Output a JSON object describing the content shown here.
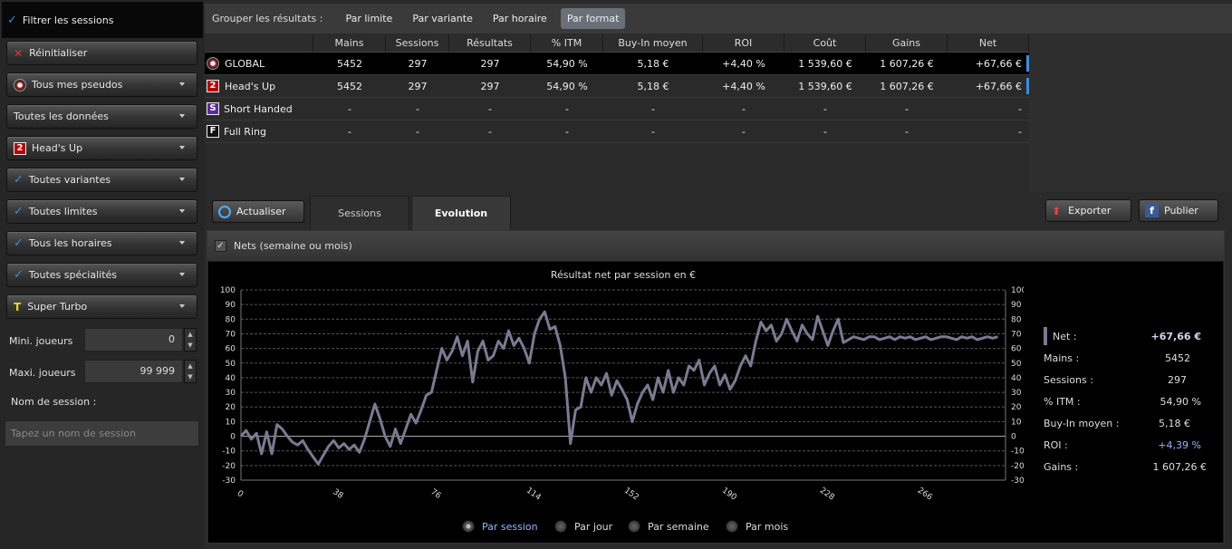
{
  "sidebar": {
    "filter_label": "Filtrer les sessions",
    "reset": "Réinitialiser",
    "pseudos": "Tous mes pseudos",
    "data": "Toutes les données",
    "format": "Head's Up",
    "variants": "Toutes variantes",
    "limits": "Toutes limites",
    "hours": "Tous les horaires",
    "specialities": "Toutes spécialités",
    "speed": "Super Turbo",
    "min_players_label": "Mini. joueurs",
    "min_players_value": "0",
    "max_players_label": "Maxi. joueurs",
    "max_players_value": "99 999",
    "session_name_label": "Nom de session :",
    "session_name_placeholder": "Tapez un nom de session"
  },
  "groupbar": {
    "label": "Grouper les résultats :",
    "tabs": [
      "Par limite",
      "Par variante",
      "Par horaire",
      "Par format"
    ],
    "selected": "Par format"
  },
  "table": {
    "columns": [
      "Mains",
      "Sessions",
      "Résultats",
      "% ITM",
      "Buy-In moyen",
      "ROI",
      "Coût",
      "Gains",
      "Net"
    ],
    "rows": [
      {
        "name": "GLOBAL",
        "icon": "global-icon",
        "cells": [
          "5452",
          "297",
          "297",
          "54,90 %",
          "5,18 €",
          "+4,40 %",
          "1 539,60 €",
          "1 607,26 €",
          "+67,66 €"
        ]
      },
      {
        "name": "Head's Up",
        "icon": "headsup-icon",
        "cells": [
          "5452",
          "297",
          "297",
          "54,90 %",
          "5,18 €",
          "+4,40 %",
          "1 539,60 €",
          "1 607,26 €",
          "+67,66 €"
        ]
      },
      {
        "name": "Short Handed",
        "icon": "shorthanded-icon",
        "cells": [
          "-",
          "-",
          "-",
          "-",
          "-",
          "-",
          "-",
          "-",
          "-"
        ]
      },
      {
        "name": "Full Ring",
        "icon": "fullring-icon",
        "cells": [
          "-",
          "-",
          "-",
          "-",
          "-",
          "-",
          "-",
          "-",
          "-"
        ]
      }
    ]
  },
  "toolbar": {
    "refresh": "Actualiser",
    "tab_sessions": "Sessions",
    "tab_evolution": "Evolution",
    "export": "Exporter",
    "publish": "Publier"
  },
  "panel": {
    "checkbox_label": "Nets (semaine ou mois)"
  },
  "stats": {
    "net_label": "Net :",
    "net_value": "+67,66 €",
    "mains_label": "Mains :",
    "mains_value": "5452",
    "sessions_label": "Sessions :",
    "sessions_value": "297",
    "itm_label": "% ITM :",
    "itm_value": "54,90 %",
    "buyin_label": "Buy-In moyen :",
    "buyin_value": "5,18 €",
    "roi_label": "ROI :",
    "roi_value": "+4,39 %",
    "gains_label": "Gains :",
    "gains_value": "1 607,26 €"
  },
  "radios": {
    "options": [
      "Par session",
      "Par jour",
      "Par semaine",
      "Par mois"
    ],
    "selected": "Par session"
  },
  "colors": {
    "accent": "#3d8be3",
    "line": "#7b7a92",
    "roi": "#8fb8ff"
  },
  "chart_data": {
    "type": "line",
    "title": "Résultat net par session en €",
    "ylim": [
      -30,
      100
    ],
    "yticks": [
      100,
      90,
      80,
      70,
      60,
      50,
      40,
      30,
      20,
      10,
      0,
      -10,
      -20,
      -30
    ],
    "xlim": [
      0,
      297
    ],
    "xticks": [
      0,
      38,
      76,
      114,
      152,
      190,
      228,
      266
    ],
    "grid": true,
    "x": [
      0,
      2,
      4,
      6,
      8,
      10,
      12,
      14,
      16,
      18,
      20,
      22,
      24,
      26,
      28,
      30,
      32,
      34,
      36,
      38,
      40,
      42,
      44,
      46,
      48,
      50,
      52,
      54,
      56,
      58,
      60,
      62,
      64,
      66,
      68,
      70,
      72,
      74,
      76,
      78,
      80,
      82,
      84,
      86,
      88,
      90,
      92,
      94,
      96,
      98,
      100,
      102,
      104,
      106,
      108,
      110,
      112,
      114,
      116,
      118,
      120,
      122,
      124,
      126,
      128,
      130,
      132,
      134,
      136,
      138,
      140,
      142,
      144,
      146,
      148,
      150,
      152,
      154,
      156,
      158,
      160,
      162,
      164,
      166,
      168,
      170,
      172,
      174,
      176,
      178,
      180,
      182,
      184,
      186,
      188,
      190,
      192,
      194,
      196,
      198,
      200,
      202,
      204,
      206,
      208,
      210,
      212,
      214,
      216,
      218,
      220,
      222,
      224,
      226,
      228,
      230,
      232,
      234,
      236,
      238,
      240,
      242,
      244,
      246,
      248,
      250,
      252,
      254,
      256,
      258,
      260,
      262,
      264,
      266,
      268,
      270,
      272,
      274,
      276,
      278,
      280,
      282,
      284,
      286,
      288,
      290,
      292,
      294,
      296
    ],
    "y": [
      0,
      4,
      -2,
      2,
      -12,
      3,
      -12,
      8,
      5,
      0,
      -4,
      -6,
      -3,
      -9,
      -14,
      -19,
      -13,
      -7,
      -3,
      -8,
      -5,
      -9,
      -6,
      -11,
      -2,
      10,
      22,
      12,
      0,
      -7,
      5,
      -5,
      5,
      15,
      9,
      18,
      28,
      30,
      45,
      60,
      52,
      58,
      68,
      55,
      65,
      37,
      58,
      65,
      52,
      55,
      65,
      60,
      72,
      62,
      67,
      60,
      50,
      70,
      80,
      85,
      73,
      75,
      62,
      40,
      -5,
      18,
      20,
      40,
      30,
      40,
      35,
      43,
      28,
      38,
      32,
      25,
      10,
      22,
      30,
      35,
      25,
      40,
      30,
      45,
      30,
      40,
      35,
      48,
      45,
      52,
      35,
      43,
      48,
      35,
      42,
      32,
      38,
      48,
      55,
      48,
      65,
      78,
      72,
      76,
      65,
      70,
      80,
      72,
      65,
      76,
      70,
      66,
      82,
      72,
      62,
      72,
      80,
      64,
      66,
      68,
      67,
      66,
      68,
      68,
      66,
      67,
      68,
      66,
      68,
      67,
      68,
      66,
      67,
      68,
      66,
      67,
      68,
      68,
      67,
      66,
      68,
      67,
      68,
      66,
      67,
      68,
      67,
      68
    ]
  }
}
